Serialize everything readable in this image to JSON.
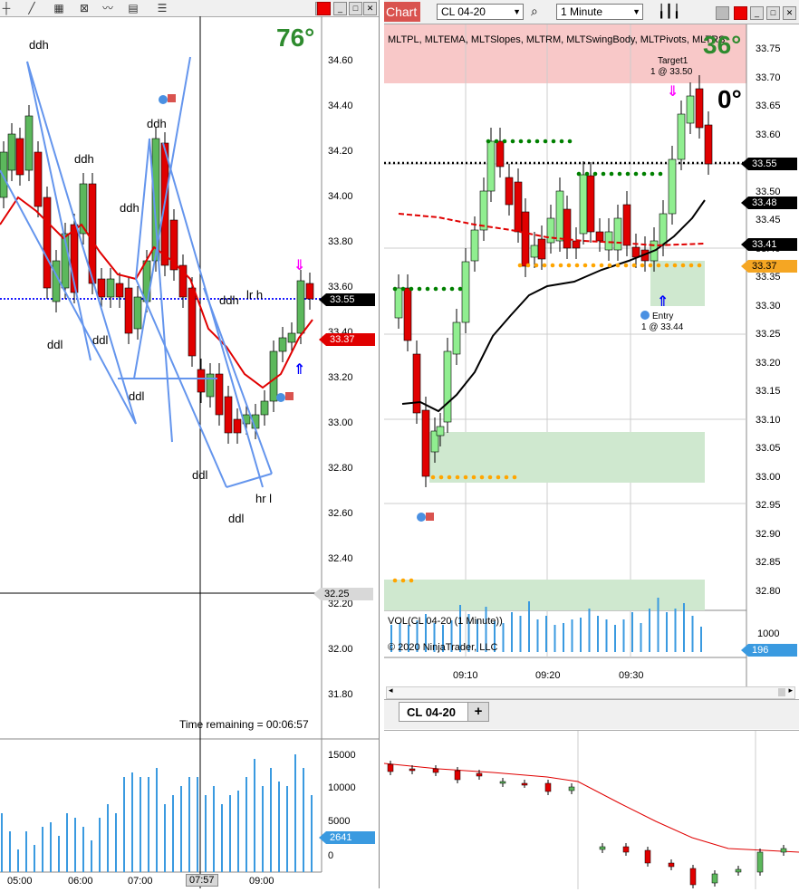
{
  "left_chart": {
    "gauge": "76°",
    "y_ticks": [
      "34.60",
      "34.40",
      "34.20",
      "34.00",
      "33.80",
      "33.60",
      "33.40",
      "33.20",
      "33.00",
      "32.80",
      "32.60",
      "32.40",
      "32.20",
      "32.00",
      "31.80"
    ],
    "price_current": "33.55",
    "price_red": "33.37",
    "price_gray": "32.25",
    "x_ticks": [
      "05:00",
      "06:00",
      "07:00",
      "09:00"
    ],
    "x_cursor": "07:57",
    "time_remaining": "Time remaining = 00:06:57",
    "volume_ticks": [
      "15000",
      "10000",
      "5000",
      "0"
    ],
    "volume_current": "2641",
    "labels": [
      "ddh",
      "ddh",
      "ddh",
      "ddh",
      "ddl",
      "ddl",
      "ddl",
      "ddl",
      "ddl",
      "ddh",
      "lr h",
      "hr l"
    ],
    "colors": {
      "bull": "#5cb85c",
      "bear": "#e00000",
      "swing": "#6495ed",
      "ma": "#e00000",
      "current_line": "#1a1aff"
    }
  },
  "right_toolbar": {
    "chart_tab": "Chart",
    "instrument": "CL 04-20",
    "interval": "1 Minute"
  },
  "right_chart": {
    "indicators": "MLTPL, MLTEMA, MLTSlopes, MLTRM, MLTSwingBody, MLTPivots, MLTRS",
    "gauge_top": "36°",
    "gauge_angle": "0°",
    "target_label": "Target1",
    "target_fill": "1 @ 33.50",
    "entry_label": "Entry",
    "entry_fill": "1 @ 33.44",
    "y_ticks": [
      "33.75",
      "33.70",
      "33.65",
      "33.60",
      "33.55",
      "33.50",
      "33.45",
      "33.40",
      "33.35",
      "33.30",
      "33.25",
      "33.20",
      "33.15",
      "33.10",
      "33.05",
      "33.00",
      "32.95",
      "32.90",
      "32.85",
      "32.80"
    ],
    "price_tags": [
      {
        "value": "33.55",
        "color": "#000000"
      },
      {
        "value": "33.48",
        "color": "#000000"
      },
      {
        "value": "33.41",
        "color": "#000000"
      },
      {
        "value": "33.37",
        "color": "#f5a623"
      }
    ],
    "volume_title": "VOL(CL 04-20 (1 Minute))",
    "copyright": "© 2020 NinjaTrader, LLC",
    "volume_tick": "1000",
    "volume_current": "196",
    "x_ticks": [
      "09:10",
      "09:20",
      "09:30"
    ]
  },
  "tab_strip": {
    "tab_label": "CL 04-20",
    "add_label": "+"
  }
}
